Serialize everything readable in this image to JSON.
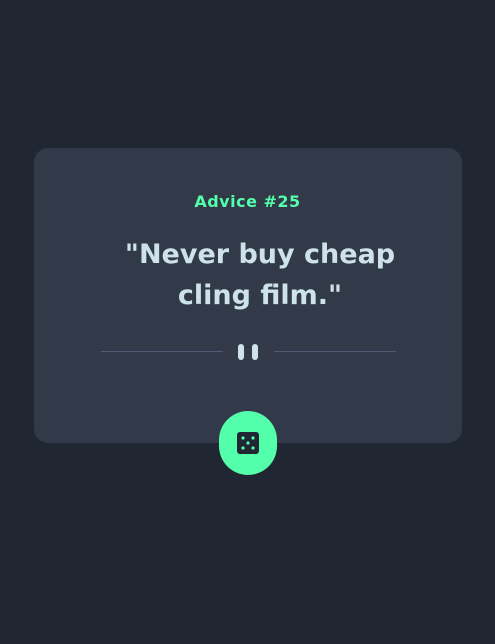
{
  "advice": {
    "label": "Advice #25",
    "quote": "\"Never buy cheap cling film.\""
  },
  "icons": {
    "divider": "pause-icon",
    "button": "dice-icon"
  },
  "colors": {
    "background": "#202632",
    "card": "#323A49",
    "accent": "#53FFAA",
    "text": "#CEE3E9",
    "divider": "#4F5D74"
  }
}
